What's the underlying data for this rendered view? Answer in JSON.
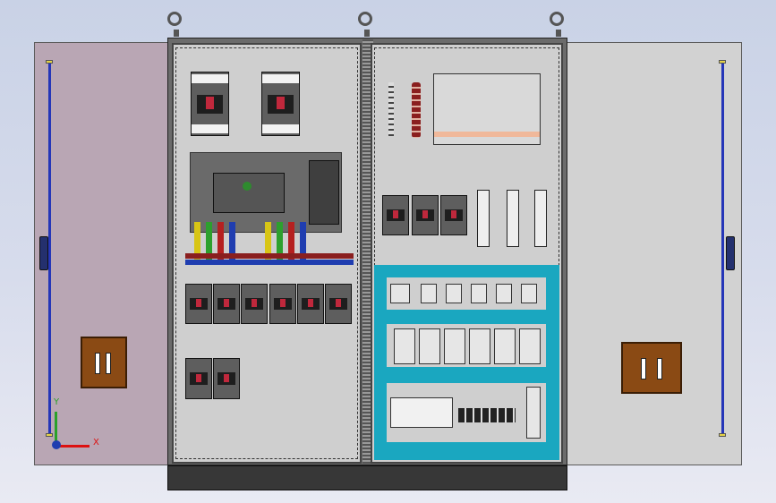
{
  "axes": {
    "x_label": "X",
    "y_label": "Y"
  },
  "colors": {
    "background": "#d2d9ea",
    "left_door": "#b9a6b4",
    "right_door": "#d2d2d2",
    "hinge": "#2536b8",
    "busbar": "#8a1f1f",
    "lock": "#8a4a14",
    "din_rail_frame": "#1aa7c0"
  },
  "icons": {
    "lifting_eye": "ring",
    "axis_triad": "xyz-triad"
  }
}
